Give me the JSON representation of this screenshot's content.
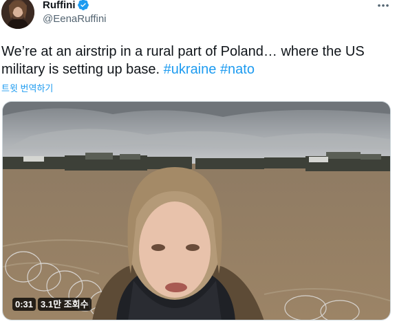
{
  "author": {
    "display_name": "Ruffini",
    "handle": "@EenaRuffini",
    "verified": true,
    "avatar_icon": "profile-photo"
  },
  "tweet": {
    "text_plain": "We’re at an airstrip in a rural part of Poland… where the US military is setting up base. ",
    "hashtags": [
      "#ukraine",
      "#nato"
    ],
    "translate_label": "트윗 번역하기"
  },
  "media": {
    "type": "video",
    "duration": "0:31",
    "views": "3.1만 조회수"
  },
  "colors": {
    "link": "#1d9bf0",
    "verified": "#1d9bf0",
    "text": "#0f1419",
    "muted": "#536471"
  },
  "icons": {
    "more": "more-horizontal-icon",
    "verified": "verified-badge-icon"
  }
}
